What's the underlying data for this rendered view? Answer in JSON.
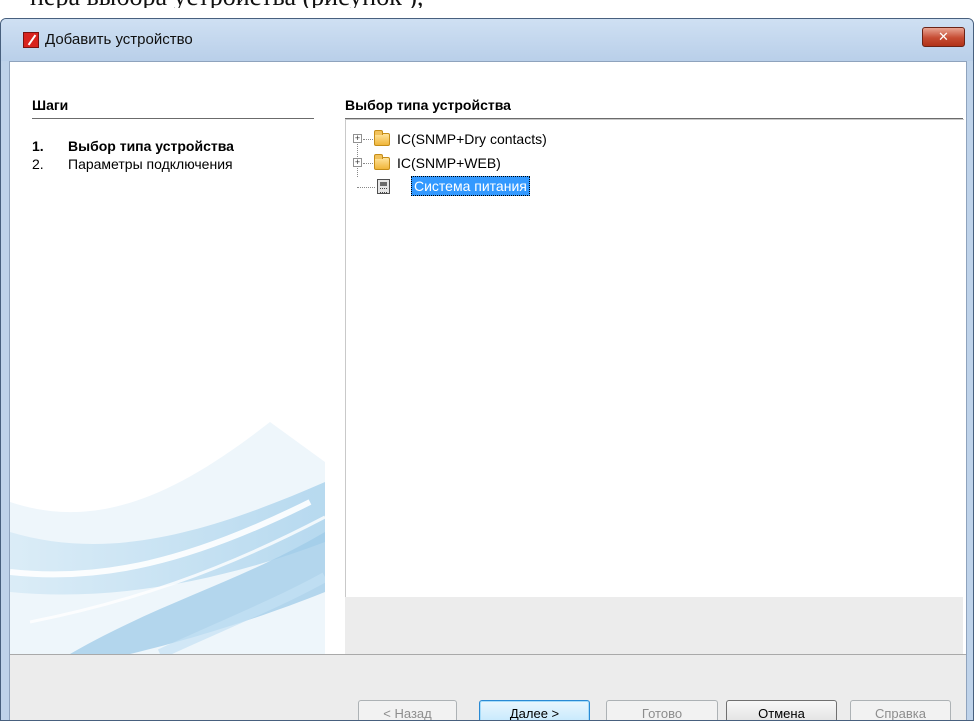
{
  "document": {
    "caption_fragment": "пера  выбора  устройства  (рисунок  ),"
  },
  "window": {
    "title": "Добавить устройство",
    "close_glyph": "✕"
  },
  "steps_panel": {
    "heading": "Шаги",
    "items": [
      {
        "number": "1.",
        "label": "Выбор типа устройства",
        "active": true
      },
      {
        "number": "2.",
        "label": "Параметры подключения",
        "active": false
      }
    ]
  },
  "main_panel": {
    "heading": "Выбор типа устройства",
    "tree": [
      {
        "label": "IC(SNMP+Dry contacts)",
        "icon": "folder-icon",
        "expandable": true,
        "selected": false
      },
      {
        "label": "IC(SNMP+WEB)",
        "icon": "folder-icon",
        "expandable": true,
        "selected": false
      },
      {
        "label": "Система питания",
        "icon": "device-icon",
        "expandable": false,
        "selected": true
      }
    ]
  },
  "buttons": {
    "back": "< Назад",
    "next": "Далее >",
    "finish": "Готово",
    "cancel": "Отмена",
    "help": "Справка"
  },
  "colors": {
    "selection": "#3399ff",
    "title_bar": "#c4d8ee",
    "close_button": "#c64c33",
    "app_icon": "#d8231e"
  }
}
